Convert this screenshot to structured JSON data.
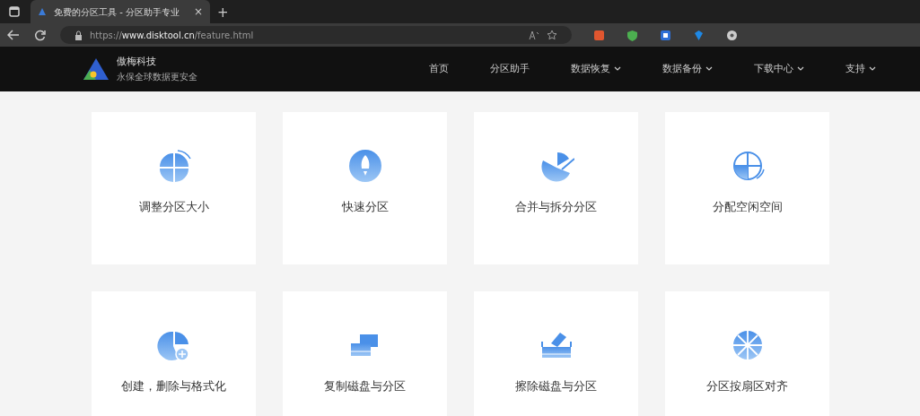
{
  "browser": {
    "tab_title": "免费的分区工具 - 分区助手专业",
    "tab_close": "×",
    "new_tab": "+",
    "url_scheme": "https://",
    "url_host": "www.disktool.cn",
    "url_path": "/feature.html"
  },
  "site": {
    "brand": "傲梅科技",
    "slogan": "永保全球数据更安全",
    "nav": [
      {
        "label": "首页",
        "dropdown": false
      },
      {
        "label": "分区助手",
        "dropdown": false
      },
      {
        "label": "数据恢复",
        "dropdown": true
      },
      {
        "label": "数据备份",
        "dropdown": true
      },
      {
        "label": "下载中心",
        "dropdown": true
      },
      {
        "label": "支持",
        "dropdown": true
      }
    ]
  },
  "features": [
    {
      "kind": "pie-arrows",
      "label": "调整分区大小"
    },
    {
      "kind": "rocket",
      "label": "快速分区"
    },
    {
      "kind": "pie-cut",
      "label": "合并与拆分分区"
    },
    {
      "kind": "quarter-arrows",
      "label": "分配空闲空间"
    },
    {
      "kind": "pie-plus",
      "label": "创建，删除与格式化"
    },
    {
      "kind": "drives",
      "label": "复制磁盘与分区"
    },
    {
      "kind": "eraser",
      "label": "擦除磁盘与分区"
    },
    {
      "kind": "wheel",
      "label": "分区按扇区对齐"
    }
  ]
}
